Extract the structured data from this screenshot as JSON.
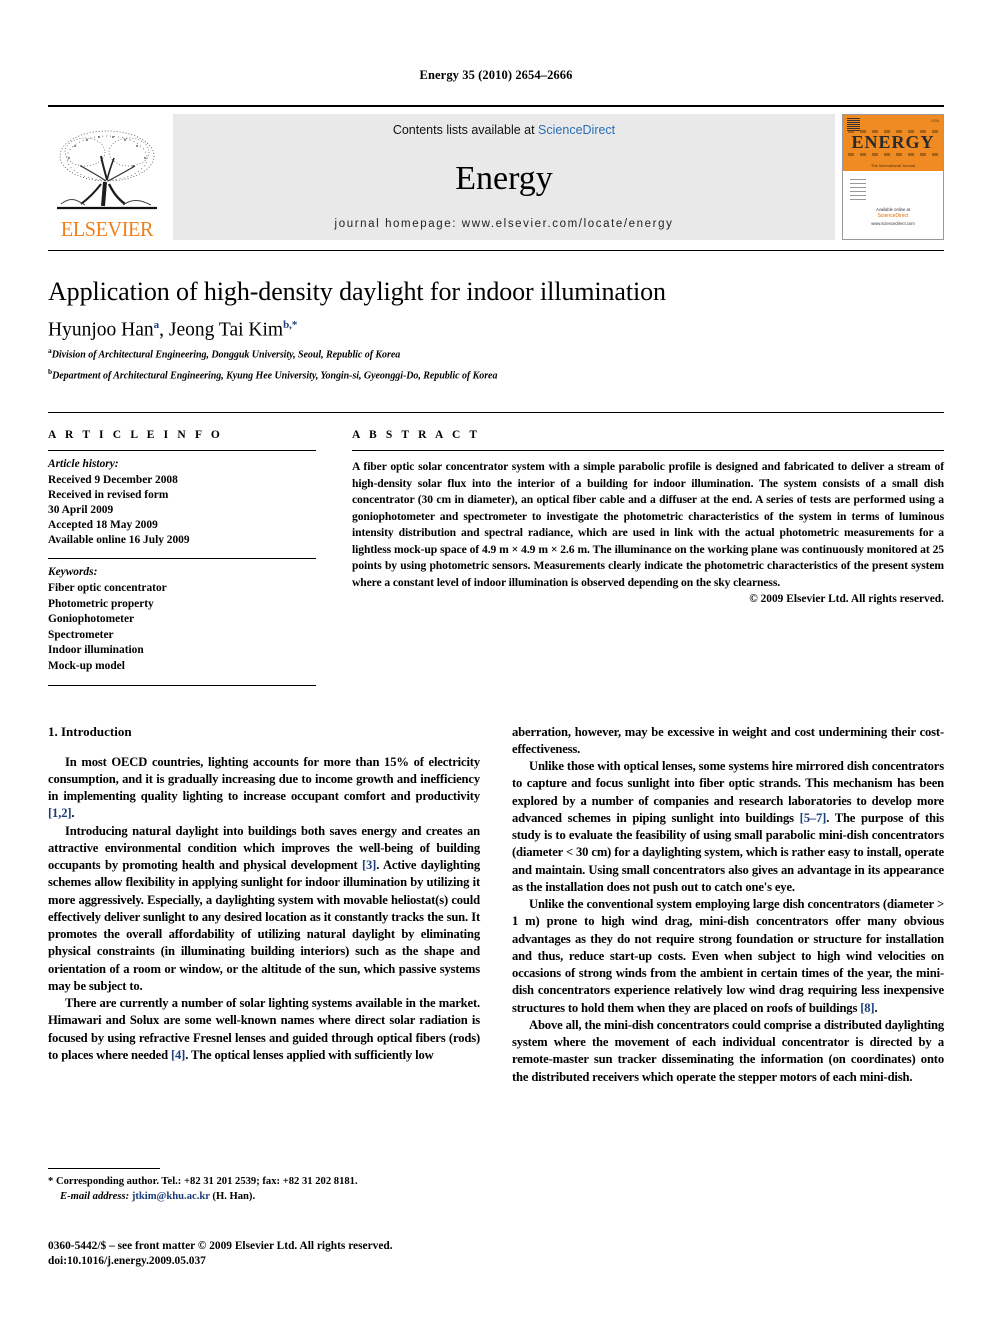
{
  "running_head": "Energy 35 (2010) 2654–2666",
  "masthead": {
    "publisher_name": "ELSEVIER",
    "contents_prefix": "Contents lists available at ",
    "contents_link": "ScienceDirect",
    "journal_name": "Energy",
    "journal_homepage": "journal homepage: www.elsevier.com/locate/energy",
    "cover": {
      "title": "ENERGY",
      "subtitle": "The International Journal",
      "sciencedirect": "Available online at",
      "sd_brand": "ScienceDirect",
      "sd_url": "www.sciencedirect.com"
    }
  },
  "article": {
    "title": "Application of high-density daylight for indoor illumination",
    "authors": [
      {
        "name": "Hyunjoo Han",
        "marker": "a"
      },
      {
        "name": "Jeong Tai Kim",
        "marker": "b,*"
      }
    ],
    "authors_line": "Hyunjoo Han",
    "affiliations": [
      {
        "marker": "a",
        "text": "Division of Architectural Engineering, Dongguk University, Seoul, Republic of Korea"
      },
      {
        "marker": "b",
        "text": "Department of Architectural Engineering, Kyung Hee University, Yongin-si, Gyeonggi-Do, Republic of Korea"
      }
    ]
  },
  "article_info": {
    "heading": "A R T I C L E   I N F O",
    "history_label": "Article history:",
    "history": [
      "Received 9 December 2008",
      "Received in revised form",
      "30 April 2009",
      "Accepted 18 May 2009",
      "Available online 16 July 2009"
    ],
    "keywords_label": "Keywords:",
    "keywords": [
      "Fiber optic concentrator",
      "Photometric property",
      "Goniophotometer",
      "Spectrometer",
      "Indoor illumination",
      "Mock-up model"
    ]
  },
  "abstract": {
    "heading": "A B S T R A C T",
    "text": "A fiber optic solar concentrator system with a simple parabolic profile is designed and fabricated to deliver a stream of high-density solar flux into the interior of a building for indoor illumination. The system consists of a small dish concentrator (30 cm in diameter), an optical fiber cable and a diffuser at the end. A series of tests are performed using a goniophotometer and spectrometer to investigate the photometric characteristics of the system in terms of luminous intensity distribution and spectral radiance, which are used in link with the actual photometric measurements for a lightless mock-up space of 4.9 m × 4.9 m × 2.6 m. The illuminance on the working plane was continuously monitored at 25 points by using photometric sensors. Measurements clearly indicate the photometric characteristics of the present system where a constant level of indoor illumination is observed depending on the sky clearness.",
    "copyright": "© 2009 Elsevier Ltd. All rights reserved."
  },
  "body": {
    "section_title": "1. Introduction",
    "left_paragraphs": [
      "In most OECD countries, lighting accounts for more than 15% of electricity consumption, and it is gradually increasing due to income growth and inefficiency in implementing quality lighting to increase occupant comfort and productivity [1,2].",
      "Introducing natural daylight into buildings both saves energy and creates an attractive environmental condition which improves the well-being of building occupants by promoting health and physical development [3]. Active daylighting schemes allow flexibility in applying sunlight for indoor illumination by utilizing it more aggressively. Especially, a daylighting system with movable heliostat(s) could effectively deliver sunlight to any desired location as it constantly tracks the sun. It promotes the overall affordability of utilizing natural daylight by eliminating physical constraints (in illuminating building interiors) such as the shape and orientation of a room or window, or the altitude of the sun, which passive systems may be subject to.",
      "There are currently a number of solar lighting systems available in the market. Himawari and Solux are some well-known names where direct solar radiation is focused by using refractive Fresnel lenses and guided through optical fibers (rods) to places where needed [4]. The optical lenses applied with sufficiently low"
    ],
    "right_paragraphs": [
      "aberration, however, may be excessive in weight and cost undermining their cost-effectiveness.",
      "Unlike those with optical lenses, some systems hire mirrored dish concentrators to capture and focus sunlight into fiber optic strands. This mechanism has been explored by a number of companies and research laboratories to develop more advanced schemes in piping sunlight into buildings [5–7]. The purpose of this study is to evaluate the feasibility of using small parabolic mini-dish concentrators (diameter < 30 cm) for a daylighting system, which is rather easy to install, operate and maintain. Using small concentrators also gives an advantage in its appearance as the installation does not push out to catch one's eye.",
      "Unlike the conventional system employing large dish concentrators (diameter > 1 m) prone to high wind drag, mini-dish concentrators offer many obvious advantages as they do not require strong foundation or structure for installation and thus, reduce start-up costs. Even when subject to high wind velocities on occasions of strong winds from the ambient in certain times of the year, the mini-dish concentrators experience relatively low wind drag requiring less inexpensive structures to hold them when they are placed on roofs of buildings [8].",
      "Above all, the mini-dish concentrators could comprise a distributed daylighting system where the movement of each individual concentrator is directed by a remote-master sun tracker disseminating the information (on coordinates) onto the distributed receivers which operate the stepper motors of each mini-dish."
    ]
  },
  "footnote": {
    "corresponding": "* Corresponding author. Tel.: +82 31 201 2539; fax: +82 31 202 8181.",
    "email_label": "E-mail address:",
    "email": "jtkim@khu.ac.kr",
    "email_suffix": "(H. Han)."
  },
  "imprint": {
    "line1": "0360-5442/$ – see front matter © 2009 Elsevier Ltd. All rights reserved.",
    "line2": "doi:10.1016/j.energy.2009.05.037"
  },
  "colors": {
    "link_blue": "#2b6fb5",
    "ref_blue": "#1b3d7a",
    "elsevier_orange": "#ee7f1a",
    "cover_orange": "#ef8b22",
    "contents_bg": "#e9e9e9"
  }
}
